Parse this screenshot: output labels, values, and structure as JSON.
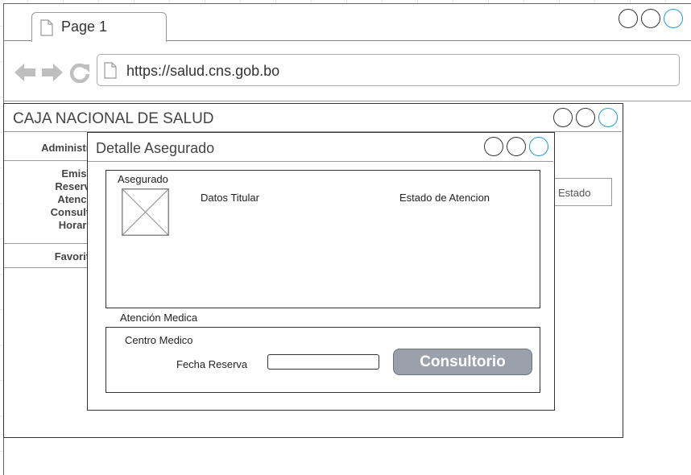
{
  "browser": {
    "tab_label": "Page 1",
    "url": "https://salud.cns.gob.bo"
  },
  "app": {
    "title": "CAJA NACIONAL DE SALUD",
    "sidebar": {
      "admin_label": "Administra",
      "menu_items": [
        "Emisio",
        "Reserva",
        "Atencio",
        "Consulto",
        "Horario"
      ],
      "favorites_label": "Favorito"
    },
    "estado_button": "Estado"
  },
  "dialog": {
    "title": "Detalle Asegurado",
    "asegurado": {
      "label": "Asegurado",
      "datos_titular": "Datos Titular",
      "estado_atencion": "Estado de Atencion"
    },
    "atencion": {
      "label": "Atención Medica",
      "centro_medico": "Centro Medico",
      "fecha_reserva_label": "Fecha Reserva",
      "fecha_reserva_value": "",
      "consultorio_button": "Consultorio"
    }
  },
  "colors": {
    "accent_blue": "#1b9cd8",
    "button_gray": "#9aa1ab"
  }
}
